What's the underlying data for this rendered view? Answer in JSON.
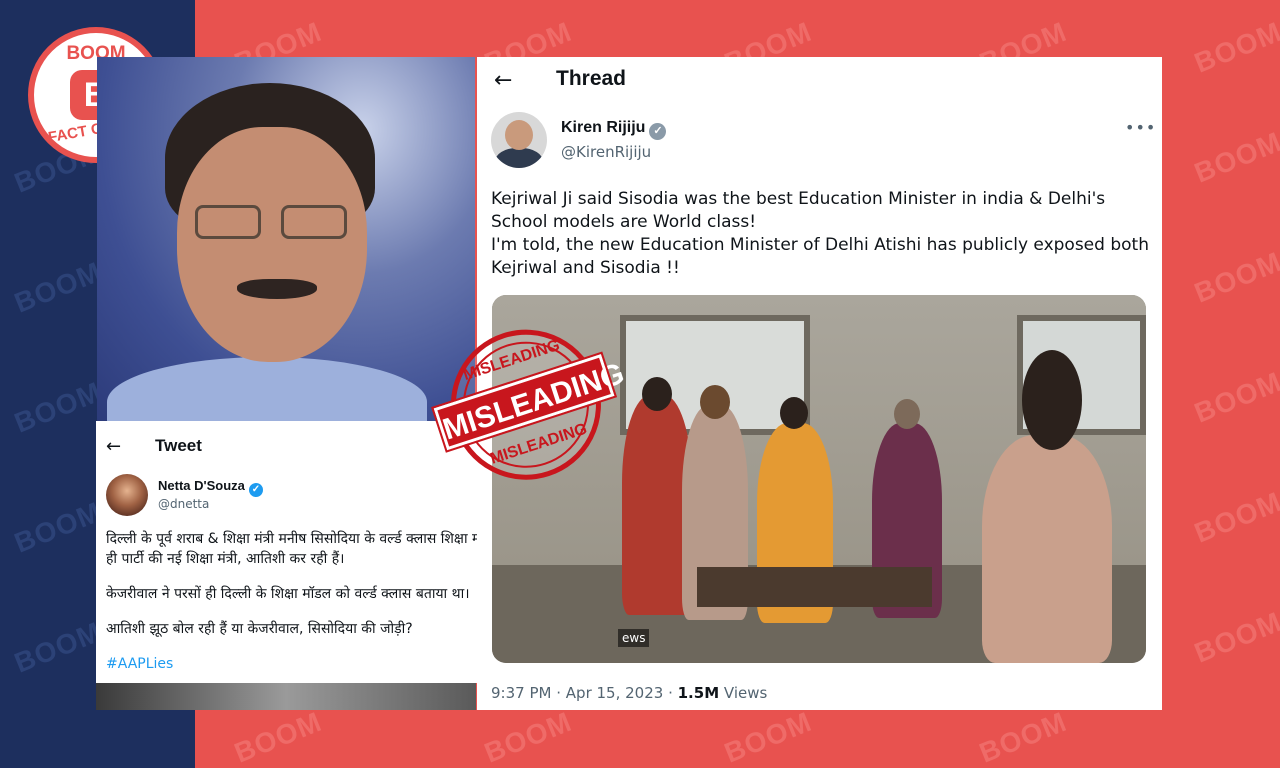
{
  "badge": {
    "top_text": "BOOM",
    "logo_letter": "B",
    "bottom_text": "FACT CHECK"
  },
  "watermark": {
    "text": "BOOM"
  },
  "stamp": {
    "top_text": "MISLEADING",
    "main_text": "MISLEADING",
    "bottom_text": "MISLEADING"
  },
  "left_tweet": {
    "back_icon": "arrow-left-icon",
    "header_title": "Tweet",
    "author_name": "Netta D'Souza",
    "author_handle": "@dnetta",
    "more_icon": "more-dots-icon",
    "paragraphs": [
      "दिल्ली के पूर्व शराब & शिक्षा मंत्री मनीष सिसोदिया के वर्ल्ड क्लास शिक्षा मॉडल का पर्दाफ़ाश उनकी ही पार्टी की नई शिक्षा मंत्री, आतिशी कर रही हैं।",
      "केजरीवाल ने परसों ही दिल्ली के शिक्षा मॉडल को वर्ल्ड क्लास बताया था।",
      "आतिशी झूठ बोल रही हैं या केजरीवाल, सिसोदिया की जोड़ी?"
    ],
    "hashtag": "#AAPLies"
  },
  "right_thread": {
    "back_icon": "arrow-left-icon",
    "header_title": "Thread",
    "author_name": "Kiren Rijiju",
    "author_handle": "@KirenRijiju",
    "more_icon": "more-dots-icon",
    "text_line1": "Kejriwal Ji said Sisodia was the best Education Minister in india & Delhi's School models are World class!",
    "text_line2": "I'm told, the new Education Minister of Delhi Atishi has publicly exposed both Kejriwal and Sisodia !!",
    "media_caption": "ews",
    "time": "9:37 PM",
    "date": "Apr 15, 2023",
    "views_count": "1.5M",
    "views_label": "Views"
  },
  "colors": {
    "brand_red": "#e8524f",
    "navy": "#1d2f5e",
    "verified_blue": "#1d9bf0",
    "stamp_red": "#c8161d"
  }
}
